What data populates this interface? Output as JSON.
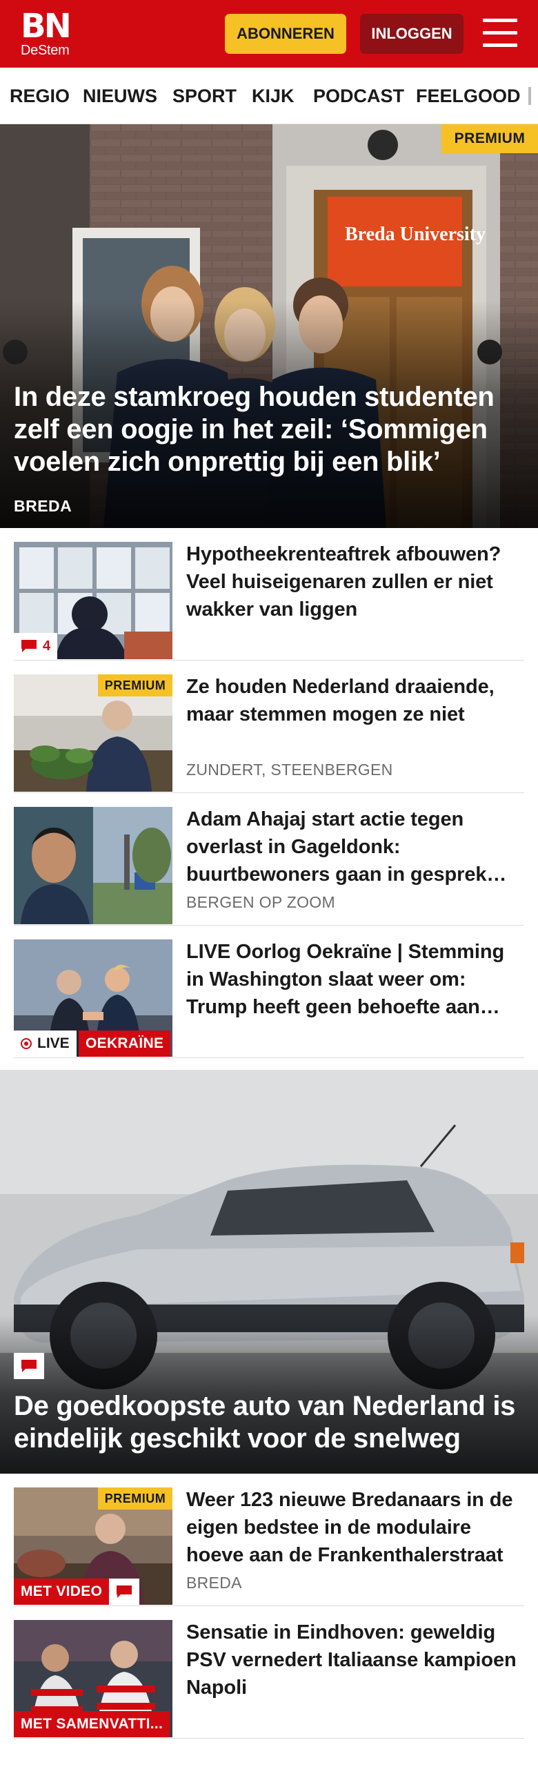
{
  "header": {
    "logo_top": "BN",
    "logo_bottom": "DeStem",
    "subscribe_label": "ABONNEREN",
    "login_label": "INLOGGEN",
    "menu_icon": "hamburger-menu-icon",
    "brand_color": "#d10a11",
    "subscribe_color": "#f5c125",
    "login_color": "#8f1015"
  },
  "nav": {
    "items": [
      "REGIO",
      "NIEUWS",
      "SPORT",
      "KIJK",
      "PODCAST",
      "FEELGOOD"
    ]
  },
  "hero": {
    "badge": "PREMIUM",
    "title": "In deze stamkroeg houden studenten zelf een oogje in het zeil: ‘Sommigen voelen zich onprettig bij een blik’",
    "location": "BREDA",
    "sign_text": "Breda University"
  },
  "articles": [
    {
      "title": "Hypotheekrenteaftrek afbouwen? Veel huiseigenaren zullen er niet wakker van liggen",
      "comment_count": "4",
      "location": ""
    },
    {
      "badge": "PREMIUM",
      "title": "Ze houden Nederland draaiende, maar stemmen mogen ze niet",
      "location": "ZUNDERT, STEENBERGEN"
    },
    {
      "title": "Adam Ahajaj start actie tegen overlast in Gageldonk: buurtbewoners gaan in gesprek met gemeente",
      "location": "BERGEN OP ZOOM"
    },
    {
      "title": "LIVE Oorlog Oekraïne | Stemming in Washington slaat weer om: Trump heeft geen behoefte aan Poetin-top",
      "live_label": "LIVE",
      "tag": "OEKRAÏNE"
    }
  ],
  "feature": {
    "title": "De goedkoopste auto van Nederland is eindelijk geschikt voor de snelweg",
    "comment_icon": "comment-icon"
  },
  "articles2": [
    {
      "badge": "PREMIUM",
      "title": "Weer 123 nieuwe Bredanaars in de eigen bedstee in de modulaire hoeve aan de Frankenthalerstraat",
      "location": "BREDA",
      "video_label": "MET VIDEO"
    },
    {
      "title": "Sensatie in Eindhoven: geweldig PSV vernedert Italiaanse kampioen Napoli",
      "summary_label": "MET SAMENVATTI..."
    }
  ]
}
